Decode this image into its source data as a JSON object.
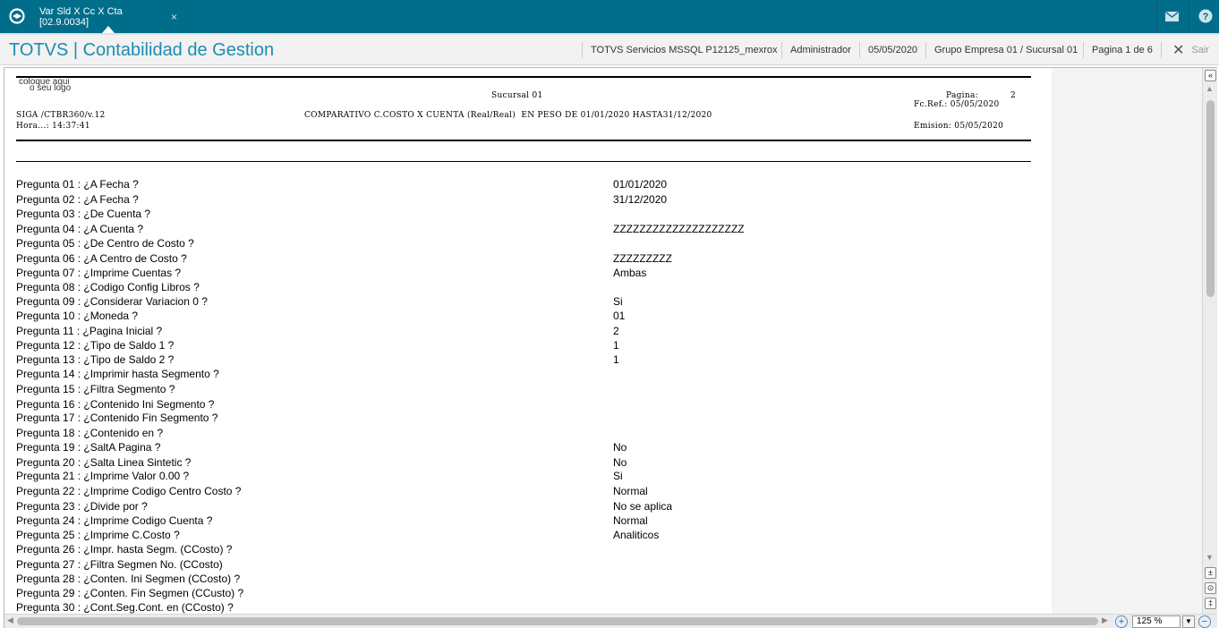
{
  "tab": {
    "title": "Var Sld X Cc X Cta [02.9.0034]",
    "close": "×"
  },
  "header": {
    "app_title": "TOTVS | Contabilidad de Gestion",
    "environment": "TOTVS Servicios MSSQL P12125_mexrox",
    "user": "Administrador",
    "date": "05/05/2020",
    "company": "Grupo Empresa 01 / Sucursal 01",
    "page": "Pagina 1 de 6",
    "exit_label": "Sair"
  },
  "report": {
    "logo_line1": "coloque aqui",
    "logo_line2": "o seu logo",
    "branch": "Sucursal 01",
    "page_label": "Pagina:",
    "page_number": "2",
    "ref_date": "Fc.Ref.: 05/05/2020",
    "program": "SIGA /CTBR360/v.12",
    "title": "COMPARATIVO C.COSTO X CUENTA (Real/Real)  EN PESO DE 01/01/2020 HASTA31/12/2020",
    "time": "Hora...: 14:37:41",
    "emission": "Emision: 05/05/2020",
    "questions": [
      {
        "label": "Pregunta 01 : ¿A Fecha ?",
        "value": "01/01/2020"
      },
      {
        "label": "Pregunta 02 : ¿A Fecha ?",
        "value": "31/12/2020"
      },
      {
        "label": "Pregunta 03 : ¿De Cuenta ?",
        "value": ""
      },
      {
        "label": "Pregunta 04 : ¿A Cuenta ?",
        "value": "ZZZZZZZZZZZZZZZZZZZZ"
      },
      {
        "label": "Pregunta 05 : ¿De Centro de Costo ?",
        "value": ""
      },
      {
        "label": "Pregunta 06 : ¿A Centro de Costo ?",
        "value": "ZZZZZZZZZ"
      },
      {
        "label": "Pregunta 07 : ¿Imprime Cuentas ?",
        "value": "Ambas"
      },
      {
        "label": "Pregunta 08 : ¿Codigo Config Libros ?",
        "value": ""
      },
      {
        "label": "Pregunta 09 : ¿Considerar Variacion 0 ?",
        "value": "Si"
      },
      {
        "label": "Pregunta 10 : ¿Moneda ?",
        "value": "01"
      },
      {
        "label": "Pregunta 11 : ¿Pagina Inicial ?",
        "value": "2"
      },
      {
        "label": "Pregunta 12 : ¿Tipo de Saldo 1 ?",
        "value": "1"
      },
      {
        "label": "Pregunta 13 : ¿Tipo de Saldo 2 ?",
        "value": "1"
      },
      {
        "label": "Pregunta 14 : ¿Imprimir hasta Segmento ?",
        "value": ""
      },
      {
        "label": "Pregunta 15 : ¿Filtra Segmento ?",
        "value": ""
      },
      {
        "label": "Pregunta 16 : ¿Contenido Ini Segmento ?",
        "value": ""
      },
      {
        "label": "Pregunta 17 : ¿Contenido Fin Segmento ?",
        "value": ""
      },
      {
        "label": "Pregunta 18 : ¿Contenido en ?",
        "value": ""
      },
      {
        "label": "Pregunta 19 : ¿SaltA Pagina ?",
        "value": "No"
      },
      {
        "label": "Pregunta 20 : ¿Salta Linea Sintetic ?",
        "value": "No"
      },
      {
        "label": "Pregunta 21 : ¿Imprime Valor 0.00 ?",
        "value": "Si"
      },
      {
        "label": "Pregunta 22 : ¿Imprime Codigo Centro Costo ?",
        "value": "Normal"
      },
      {
        "label": "Pregunta 23 : ¿Divide por ?",
        "value": "No se aplica"
      },
      {
        "label": "Pregunta 24 : ¿Imprime Codigo Cuenta ?",
        "value": "Normal"
      },
      {
        "label": "Pregunta 25 : ¿Imprime C.Costo ?",
        "value": "Analiticos"
      },
      {
        "label": "Pregunta 26 : ¿Impr. hasta Segm. (CCosto) ?",
        "value": ""
      },
      {
        "label": "Pregunta 27 : ¿Filtra Segmen No.   (CCosto)",
        "value": ""
      },
      {
        "label": "Pregunta 28 : ¿Conten. Ini Segmen (CCosto) ?",
        "value": ""
      },
      {
        "label": "Pregunta 29 : ¿Conten. Fin Segmen (CCusto) ?",
        "value": ""
      },
      {
        "label": "Pregunta 30 : ¿Cont.Seg.Cont. en (CCosto) ?",
        "value": ""
      }
    ]
  },
  "viewer": {
    "zoom": "125 %"
  },
  "icons": {
    "app_logo": "totvs-logo-icon",
    "mail": "mail-icon",
    "help": "help-icon",
    "exit": "close-icon"
  },
  "colors": {
    "topbar": "#006e8a",
    "title": "#1d8cb0"
  }
}
